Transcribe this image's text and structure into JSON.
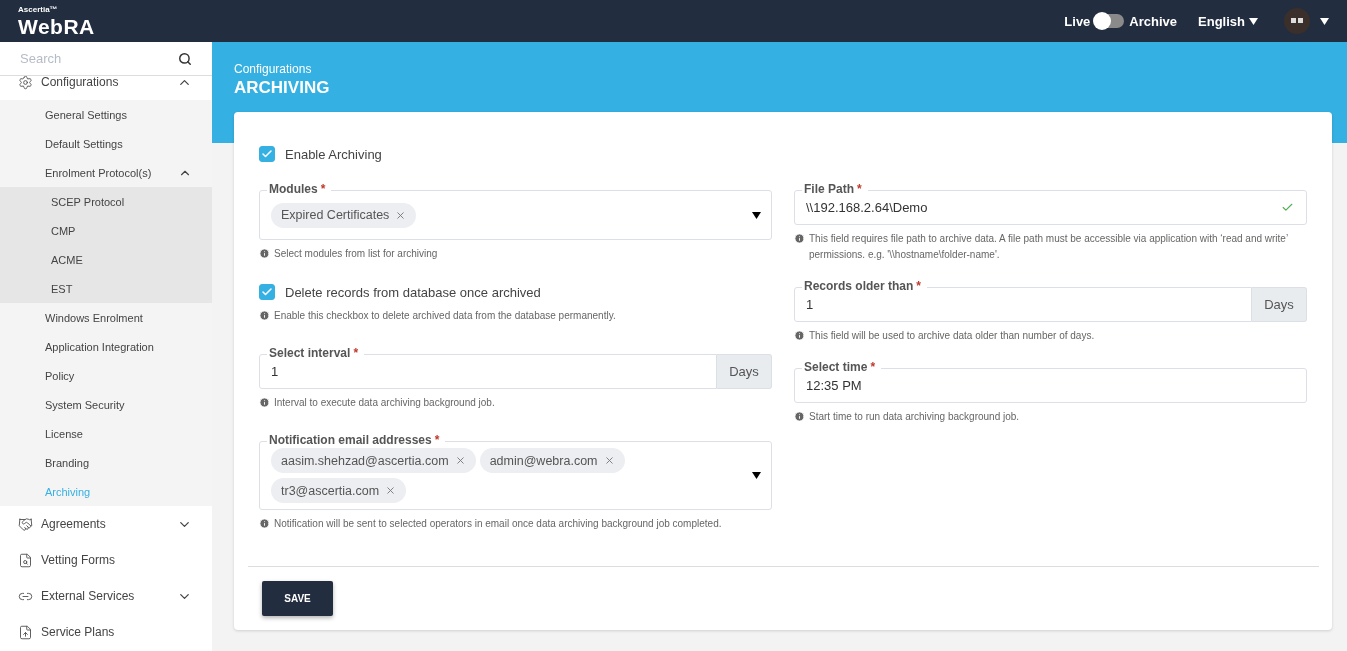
{
  "header": {
    "logo_small": "Ascertia™",
    "logo": "WebRA",
    "mode_toggle": {
      "left_label": "Live",
      "right_label": "Archive",
      "on": false
    },
    "language": "English"
  },
  "sidebar": {
    "search": {
      "placeholder": "Search"
    },
    "items": [
      {
        "label": "Configurations",
        "selected": false,
        "expanded": true,
        "children": [
          {
            "label": "General Settings",
            "selected": false
          },
          {
            "label": "Default Settings",
            "selected": false
          },
          {
            "label": "Enrolment Protocol(s)",
            "selected": false,
            "expanded": true,
            "children": [
              {
                "label": "SCEP Protocol",
                "selected": false
              },
              {
                "label": "CMP",
                "selected": false
              },
              {
                "label": "ACME",
                "selected": false
              },
              {
                "label": "EST",
                "selected": false
              }
            ]
          },
          {
            "label": "Windows Enrolment",
            "selected": false
          },
          {
            "label": "Application Integration",
            "selected": false
          },
          {
            "label": "Policy",
            "selected": false
          },
          {
            "label": "System Security",
            "selected": false
          },
          {
            "label": "License",
            "selected": false
          },
          {
            "label": "Branding",
            "selected": false
          },
          {
            "label": "Archiving",
            "selected": true
          }
        ]
      },
      {
        "label": "Agreements",
        "selected": false,
        "expanded": false
      },
      {
        "label": "Vetting Forms",
        "selected": false
      },
      {
        "label": "External Services",
        "selected": false,
        "expanded": false
      },
      {
        "label": "Service Plans",
        "selected": false
      }
    ]
  },
  "page": {
    "breadcrumb": "Configurations",
    "title": "ARCHIVING"
  },
  "form": {
    "enable": {
      "label": "Enable Archiving",
      "checked": true
    },
    "left": [
      {
        "kind": "tags",
        "label": "Modules",
        "required_mark": "*",
        "tags": [
          "Expired Certificates"
        ],
        "hint": "Select modules from list for archiving"
      },
      {
        "kind": "checkbox",
        "label": "Delete records from database once archived",
        "checked": true,
        "hint": "Enable this checkbox to delete archived data from the database permanently."
      },
      {
        "kind": "addon",
        "label": "Select interval",
        "required_mark": "*",
        "value": "1",
        "addon": "Days",
        "hint": "Interval to execute data archiving background job."
      },
      {
        "kind": "tags",
        "label": "Notification email addresses",
        "required_mark": "*",
        "tags": [
          "aasim.shehzad@ascertia.com",
          "admin@webra.com",
          "tr3@ascertia.com"
        ],
        "hint": "Notification will be sent to selected operators in email once data archiving background job completed."
      }
    ],
    "right": [
      {
        "kind": "text",
        "label": "File Path",
        "required_mark": "*",
        "value": "\\\\192.168.2.64\\Demo",
        "valid": true,
        "hint": "This field requires file path to archive data. A file path must be accessible via application with ‘read and write’ permissions. e.g. '\\\\hostname\\folder-name'."
      },
      {
        "kind": "addon",
        "label": "Records older than",
        "required_mark": "*",
        "value": "1",
        "addon": "Days",
        "hint": "This field will be used to archive data older than number of days."
      },
      {
        "kind": "text",
        "label": "Select time",
        "required_mark": "*",
        "value": "12:35 PM",
        "hint": "Start time to run data archiving background job."
      }
    ],
    "save": "SAVE"
  }
}
